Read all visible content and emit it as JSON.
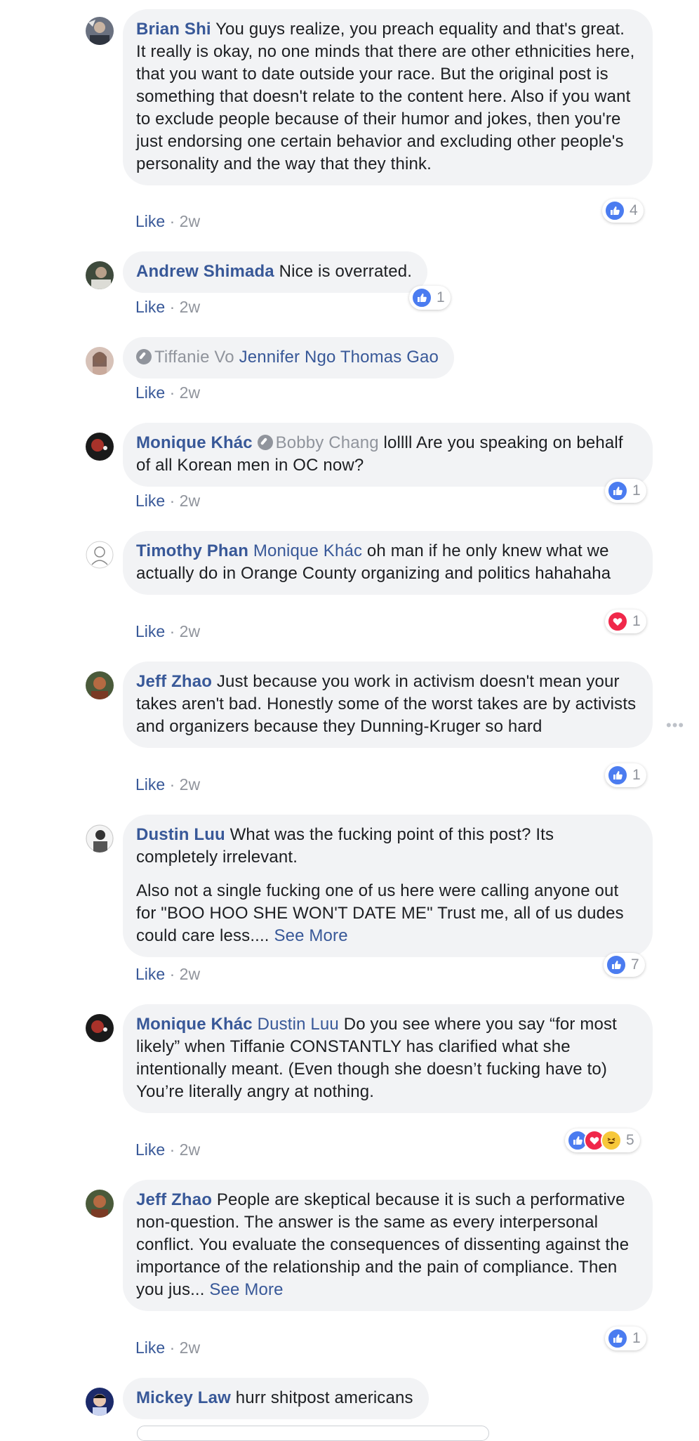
{
  "comments": [
    {
      "author": "Brian Shi",
      "text": " You guys realize, you preach equality and that's great. It really is okay, no one minds that there are other ethnicities here, that you want to date outside your race. But the original post is something that doesn't relate to the content here. Also if you want to exclude people because of their humor and jokes, then you're just endorsing one certain behavior and excluding other people's personality and the way that they think.",
      "like_label": "Like",
      "time": "2w",
      "reactions": [
        "like"
      ],
      "reaction_count": "4"
    },
    {
      "author": "Andrew Shimada",
      "text": " Nice is overrated.",
      "like_label": "Like",
      "time": "2w",
      "reactions": [
        "like"
      ],
      "reaction_count": "1"
    },
    {
      "author": "Tiffanie Vo",
      "mention": "Jennifer Ngo Thomas Gao",
      "like_label": "Like",
      "time": "2w"
    },
    {
      "author": "Monique Khác",
      "muted_mention": "Bobby Chang",
      "text": " lollll Are you speaking on behalf of all Korean men in OC now?",
      "like_label": "Like",
      "time": "2w",
      "reactions": [
        "like"
      ],
      "reaction_count": "1"
    },
    {
      "author": "Timothy Phan",
      "mention": "Monique Khác",
      "text": " oh man if he only knew what we actually do in Orange County organizing and politics hahahaha",
      "like_label": "Like",
      "time": "2w",
      "reactions": [
        "love"
      ],
      "reaction_count": "1"
    },
    {
      "author": "Jeff Zhao",
      "text": " Just because you work in activism doesn't mean your takes aren't bad. Honestly some of the worst takes are by activists and organizers because they Dunning-Kruger so hard",
      "like_label": "Like",
      "time": "2w",
      "reactions": [
        "like"
      ],
      "reaction_count": "1"
    },
    {
      "author": "Dustin Luu",
      "text": " What was the fucking point of this post? Its completely irrelevant.",
      "text2": "Also not a single fucking one of us here were calling anyone out for \"BOO HOO SHE WON'T DATE ME\" Trust me, all of us dudes could care less....",
      "see_more": "See More",
      "like_label": "Like",
      "time": "2w",
      "reactions": [
        "like"
      ],
      "reaction_count": "7"
    },
    {
      "author": "Monique Khác",
      "mention": "Dustin Luu",
      "text": " Do you see where you say “for most likely” when Tiffanie CONSTANTLY has clarified what she intentionally meant. (Even though she doesn’t fucking have to)",
      "text2": "You’re literally angry at nothing.",
      "like_label": "Like",
      "time": "2w",
      "reactions": [
        "like",
        "love",
        "haha"
      ],
      "reaction_count": "5"
    },
    {
      "author": "Jeff Zhao",
      "text": " People are skeptical because it is such a performative non-question. The answer is the same as every interpersonal conflict. You evaluate the consequences of dissenting against the importance of the relationship and the pain of compliance. Then you jus...",
      "see_more": "See More",
      "like_label": "Like",
      "time": "2w",
      "reactions": [
        "like"
      ],
      "reaction_count": "1"
    },
    {
      "author": "Mickey Law",
      "text": " hurr shitpost americans"
    }
  ],
  "colors": {
    "link": "#385898",
    "bubble": "#f2f3f5",
    "muted": "#90949c",
    "like": "#4b7cf0",
    "love": "#f0284a",
    "haha": "#f7c83a"
  }
}
